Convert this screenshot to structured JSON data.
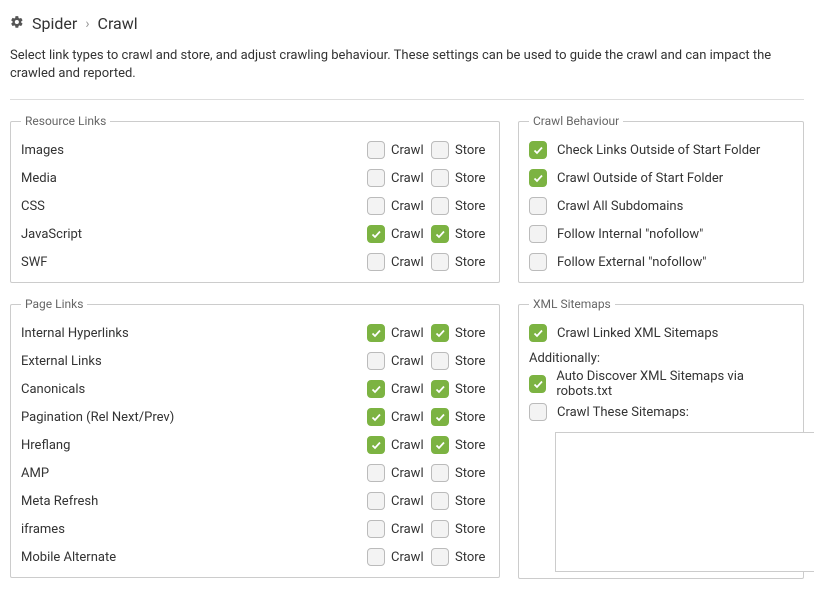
{
  "breadcrumb": {
    "root": "Spider",
    "page": "Crawl"
  },
  "description": "Select link types to crawl and store, and adjust crawling behaviour. These settings can be used to guide the crawl and can impact the crawled and reported.",
  "labels": {
    "crawl": "Crawl",
    "store": "Store"
  },
  "groups": {
    "resourceLinks": {
      "title": "Resource Links",
      "rows": [
        {
          "label": "Images",
          "crawl": false,
          "store": false
        },
        {
          "label": "Media",
          "crawl": false,
          "store": false
        },
        {
          "label": "CSS",
          "crawl": false,
          "store": false
        },
        {
          "label": "JavaScript",
          "crawl": true,
          "store": true
        },
        {
          "label": "SWF",
          "crawl": false,
          "store": false
        }
      ]
    },
    "pageLinks": {
      "title": "Page Links",
      "rows": [
        {
          "label": "Internal Hyperlinks",
          "crawl": true,
          "store": true
        },
        {
          "label": "External Links",
          "crawl": false,
          "store": false
        },
        {
          "label": "Canonicals",
          "crawl": true,
          "store": true
        },
        {
          "label": "Pagination (Rel Next/Prev)",
          "crawl": true,
          "store": true
        },
        {
          "label": "Hreflang",
          "crawl": true,
          "store": true
        },
        {
          "label": "AMP",
          "crawl": false,
          "store": false
        },
        {
          "label": "Meta Refresh",
          "crawl": false,
          "store": false
        },
        {
          "label": "iframes",
          "crawl": false,
          "store": false
        },
        {
          "label": "Mobile Alternate",
          "crawl": false,
          "store": false
        }
      ]
    },
    "crawlBehaviour": {
      "title": "Crawl Behaviour",
      "rows": [
        {
          "label": "Check Links Outside of Start Folder",
          "checked": true
        },
        {
          "label": "Crawl Outside of Start Folder",
          "checked": true
        },
        {
          "label": "Crawl All Subdomains",
          "checked": false
        },
        {
          "label": "Follow Internal \"nofollow\"",
          "checked": false
        },
        {
          "label": "Follow External \"nofollow\"",
          "checked": false
        }
      ]
    },
    "xmlSitemaps": {
      "title": "XML Sitemaps",
      "crawlLinked": {
        "label": "Crawl Linked XML Sitemaps",
        "checked": true
      },
      "additionally": "Additionally:",
      "autoDiscover": {
        "label": "Auto Discover XML Sitemaps via robots.txt",
        "checked": true
      },
      "crawlThese": {
        "label": "Crawl These Sitemaps:",
        "checked": false
      }
    }
  }
}
